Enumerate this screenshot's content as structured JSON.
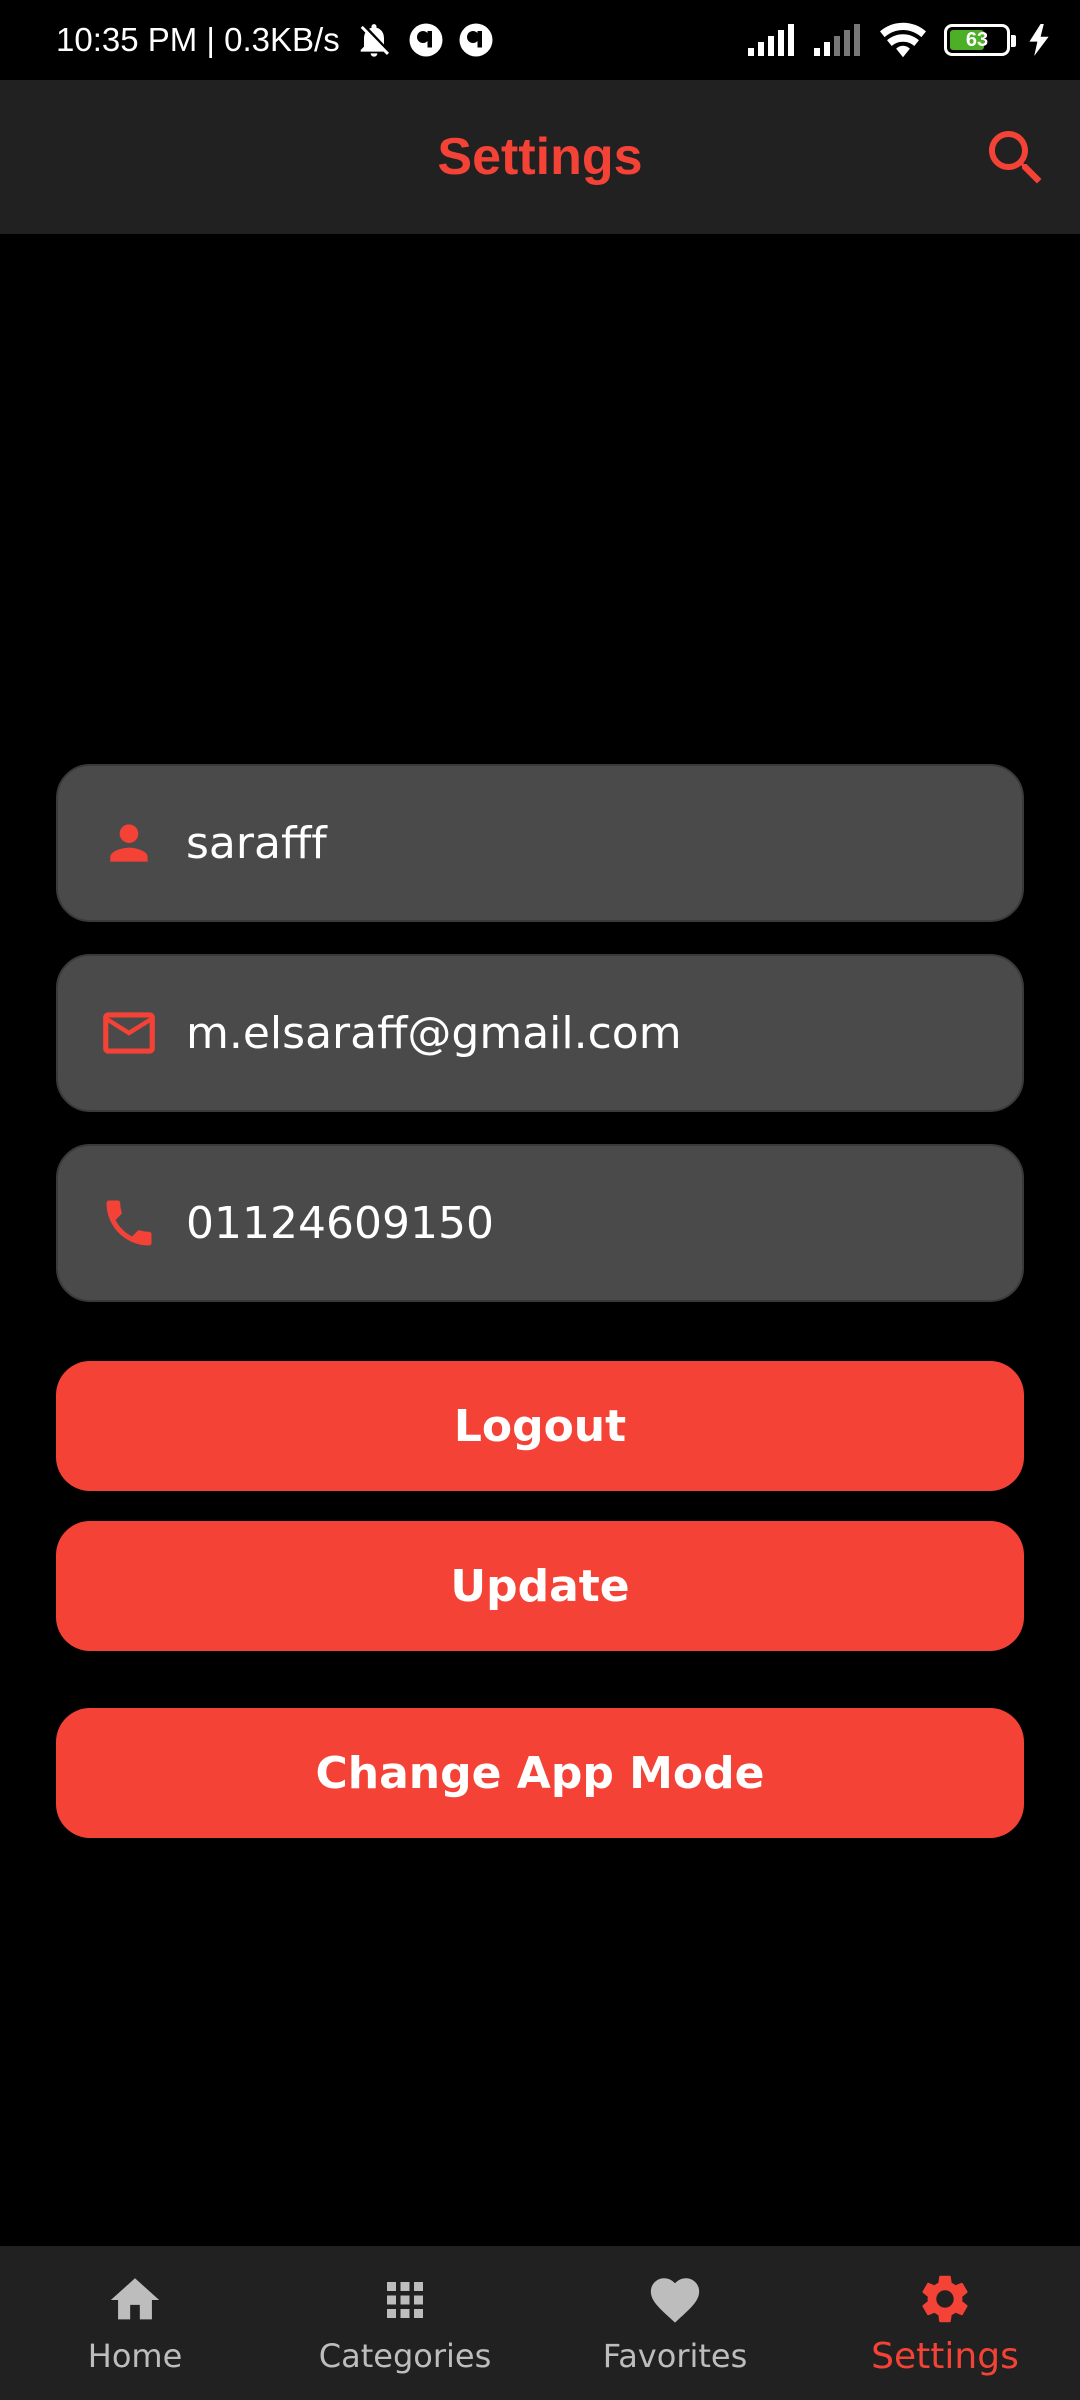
{
  "status_bar": {
    "time_speed": "10:35 PM | 0.3KB/s",
    "battery_level": "63",
    "battery_fraction": 0.63
  },
  "app_bar": {
    "title": "Settings",
    "search_icon": "search-icon"
  },
  "profile": {
    "name": "sarafff",
    "email": "m.elsaraff@gmail.com",
    "phone": "01124609150",
    "name_icon": "person-icon",
    "email_icon": "mail-icon",
    "phone_icon": "phone-icon"
  },
  "actions": {
    "logout": "Logout",
    "update": "Update",
    "change_mode": "Change App Mode"
  },
  "bottom_nav": {
    "items": [
      {
        "label": "Home",
        "icon": "home-icon"
      },
      {
        "label": "Categories",
        "icon": "grid-icon"
      },
      {
        "label": "Favorites",
        "icon": "heart-icon"
      },
      {
        "label": "Settings",
        "icon": "gear-icon"
      }
    ],
    "active": "Settings"
  },
  "colors": {
    "accent": "#f44336",
    "background": "#000000",
    "bar": "#212121",
    "field": "#4a4a4a",
    "inactive": "#bdbdbd"
  }
}
